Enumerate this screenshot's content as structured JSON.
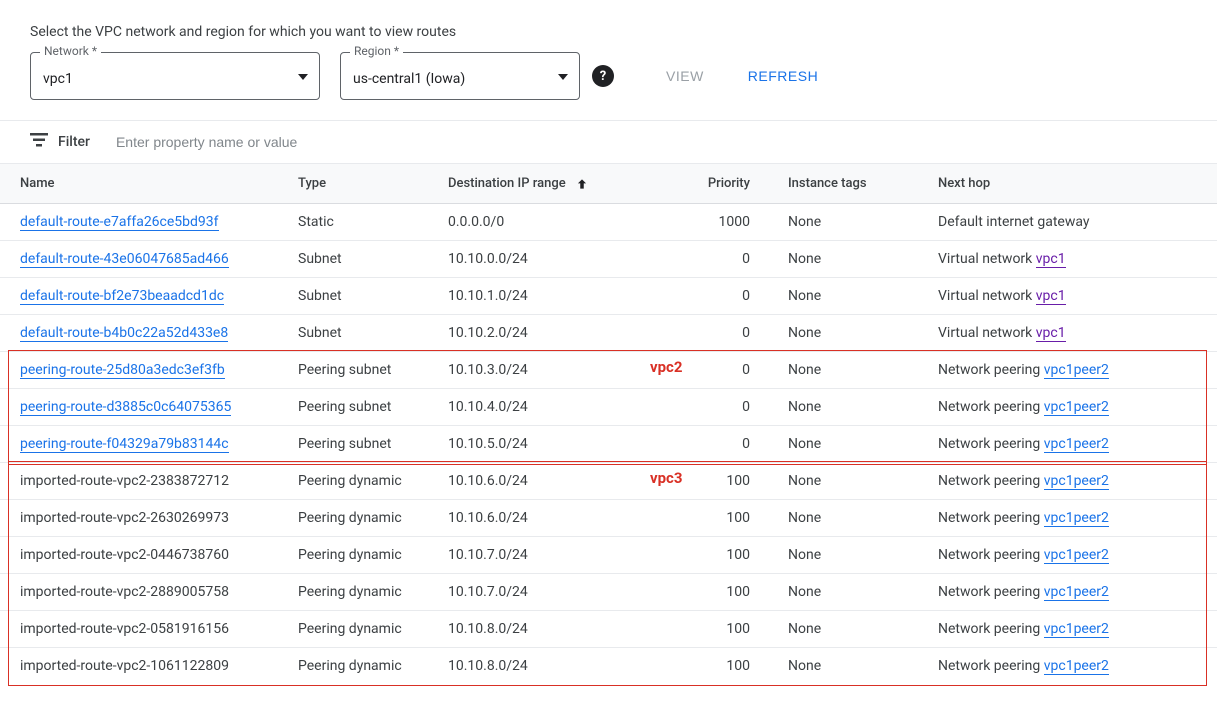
{
  "instruction": "Select the VPC network and region for which you want to view routes",
  "selectors": {
    "network_label": "Network *",
    "network_value": "vpc1",
    "region_label": "Region *",
    "region_value": "us-central1 (Iowa)"
  },
  "buttons": {
    "view": "VIEW",
    "refresh": "REFRESH"
  },
  "filter": {
    "label": "Filter",
    "placeholder": "Enter property name or value"
  },
  "columns": {
    "name": "Name",
    "type": "Type",
    "dest": "Destination IP range",
    "priority": "Priority",
    "tags": "Instance tags",
    "next": "Next hop"
  },
  "next_hop_prefix": {
    "default_gateway": "Default internet gateway",
    "virtual_network": "Virtual network",
    "network_peering": "Network peering"
  },
  "annotations": {
    "box1_label": "vpc2",
    "box2_label": "vpc3"
  },
  "rows": [
    {
      "name": "default-route-e7affa26ce5bd93f",
      "name_link": true,
      "type": "Static",
      "dest": "0.0.0.0/0",
      "priority": "1000",
      "tags": "None",
      "next_kind": "gateway",
      "next_link": ""
    },
    {
      "name": "default-route-43e06047685ad466",
      "name_link": true,
      "type": "Subnet",
      "dest": "10.10.0.0/24",
      "priority": "0",
      "tags": "None",
      "next_kind": "vnet",
      "next_link": "vpc1"
    },
    {
      "name": "default-route-bf2e73beaadcd1dc",
      "name_link": true,
      "type": "Subnet",
      "dest": "10.10.1.0/24",
      "priority": "0",
      "tags": "None",
      "next_kind": "vnet",
      "next_link": "vpc1"
    },
    {
      "name": "default-route-b4b0c22a52d433e8",
      "name_link": true,
      "type": "Subnet",
      "dest": "10.10.2.0/24",
      "priority": "0",
      "tags": "None",
      "next_kind": "vnet",
      "next_link": "vpc1"
    },
    {
      "name": "peering-route-25d80a3edc3ef3fb",
      "name_link": true,
      "type": "Peering subnet",
      "dest": "10.10.3.0/24",
      "priority": "0",
      "tags": "None",
      "next_kind": "peer",
      "next_link": "vpc1peer2"
    },
    {
      "name": "peering-route-d3885c0c64075365",
      "name_link": true,
      "type": "Peering subnet",
      "dest": "10.10.4.0/24",
      "priority": "0",
      "tags": "None",
      "next_kind": "peer",
      "next_link": "vpc1peer2"
    },
    {
      "name": "peering-route-f04329a79b83144c",
      "name_link": true,
      "type": "Peering subnet",
      "dest": "10.10.5.0/24",
      "priority": "0",
      "tags": "None",
      "next_kind": "peer",
      "next_link": "vpc1peer2"
    },
    {
      "name": "imported-route-vpc2-2383872712",
      "name_link": false,
      "type": "Peering dynamic",
      "dest": "10.10.6.0/24",
      "priority": "100",
      "tags": "None",
      "next_kind": "peer",
      "next_link": "vpc1peer2"
    },
    {
      "name": "imported-route-vpc2-2630269973",
      "name_link": false,
      "type": "Peering dynamic",
      "dest": "10.10.6.0/24",
      "priority": "100",
      "tags": "None",
      "next_kind": "peer",
      "next_link": "vpc1peer2"
    },
    {
      "name": "imported-route-vpc2-0446738760",
      "name_link": false,
      "type": "Peering dynamic",
      "dest": "10.10.7.0/24",
      "priority": "100",
      "tags": "None",
      "next_kind": "peer",
      "next_link": "vpc1peer2"
    },
    {
      "name": "imported-route-vpc2-2889005758",
      "name_link": false,
      "type": "Peering dynamic",
      "dest": "10.10.7.0/24",
      "priority": "100",
      "tags": "None",
      "next_kind": "peer",
      "next_link": "vpc1peer2"
    },
    {
      "name": "imported-route-vpc2-0581916156",
      "name_link": false,
      "type": "Peering dynamic",
      "dest": "10.10.8.0/24",
      "priority": "100",
      "tags": "None",
      "next_kind": "peer",
      "next_link": "vpc1peer2"
    },
    {
      "name": "imported-route-vpc2-1061122809",
      "name_link": false,
      "type": "Peering dynamic",
      "dest": "10.10.8.0/24",
      "priority": "100",
      "tags": "None",
      "next_kind": "peer",
      "next_link": "vpc1peer2"
    }
  ]
}
